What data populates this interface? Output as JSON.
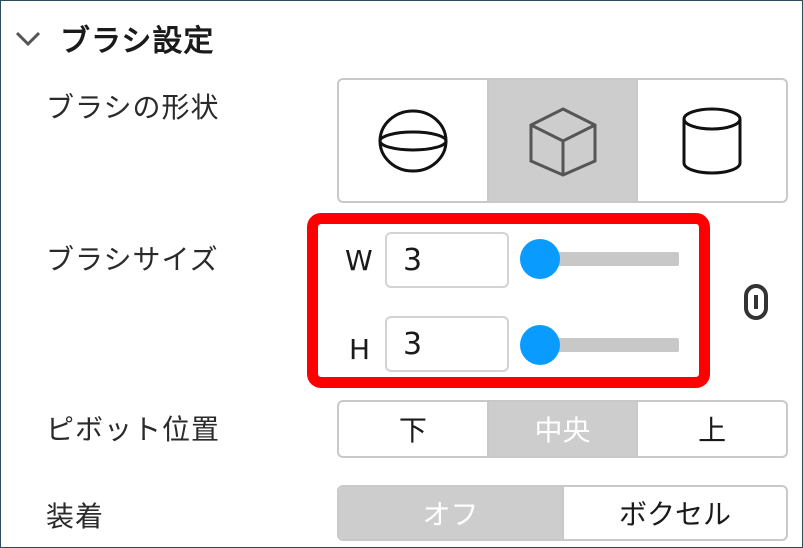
{
  "panel": {
    "title": "ブラシ設定",
    "brush_shape": {
      "label": "ブラシの形状",
      "options": [
        {
          "icon": "sphere-icon",
          "selected": false
        },
        {
          "icon": "cube-icon",
          "selected": true
        },
        {
          "icon": "cylinder-icon",
          "selected": false
        }
      ]
    },
    "brush_size": {
      "label": "ブラシサイズ",
      "width": {
        "axis_label": "W",
        "value": "3"
      },
      "height": {
        "axis_label": "H",
        "value": "3"
      },
      "highlight_color": "#ff0000",
      "slider_color": "#0a9bff",
      "link_icon": "link-icon"
    },
    "pivot": {
      "label": "ピボット位置",
      "options": [
        "下",
        "中央",
        "上"
      ],
      "selected": "中央"
    },
    "attach": {
      "label": "装着",
      "options": [
        "オフ",
        "ボクセル"
      ],
      "selected": "オフ"
    }
  }
}
